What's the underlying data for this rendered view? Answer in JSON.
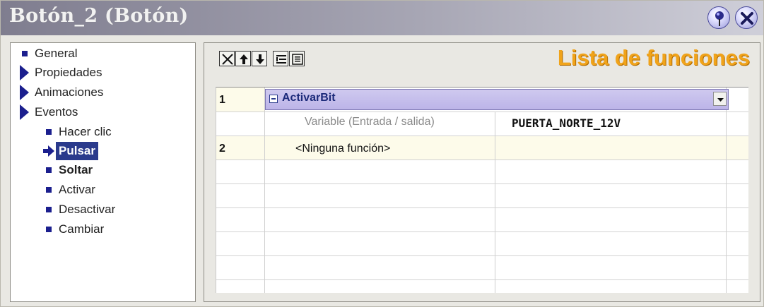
{
  "window": {
    "title": "Botón_2 (Botón)"
  },
  "nav": {
    "items": [
      {
        "label": "General",
        "marker": "bullet"
      },
      {
        "label": "Propiedades",
        "marker": "expand-triangle"
      },
      {
        "label": "Animaciones",
        "marker": "expand-triangle"
      },
      {
        "label": "Eventos",
        "marker": "expand-triangle"
      }
    ],
    "events": [
      {
        "label": "Hacer clic",
        "state": "normal"
      },
      {
        "label": "Pulsar",
        "state": "selected"
      },
      {
        "label": "Soltar",
        "state": "configured"
      },
      {
        "label": "Activar",
        "state": "normal"
      },
      {
        "label": "Desactivar",
        "state": "normal"
      },
      {
        "label": "Cambiar",
        "state": "normal"
      }
    ]
  },
  "panel": {
    "heading": "Lista de funciones",
    "toolbar": [
      "delete-icon",
      "move-up-icon",
      "move-down-icon",
      "indent-icon",
      "list-icon"
    ],
    "rows": [
      {
        "number": "1",
        "function": "ActivarBit",
        "param_label": "Variable (Entrada / salida)",
        "param_value": "PUERTA_NORTE_12V"
      },
      {
        "number": "2",
        "function": "<Ninguna función>"
      }
    ]
  },
  "colors": {
    "title_gradient_start": "#7f7d8f",
    "heading_orange": "#f0a31a",
    "selection_blue": "#2a3a8c",
    "row_highlight": "#c4bdeb",
    "row_cream": "#fdfbea"
  }
}
